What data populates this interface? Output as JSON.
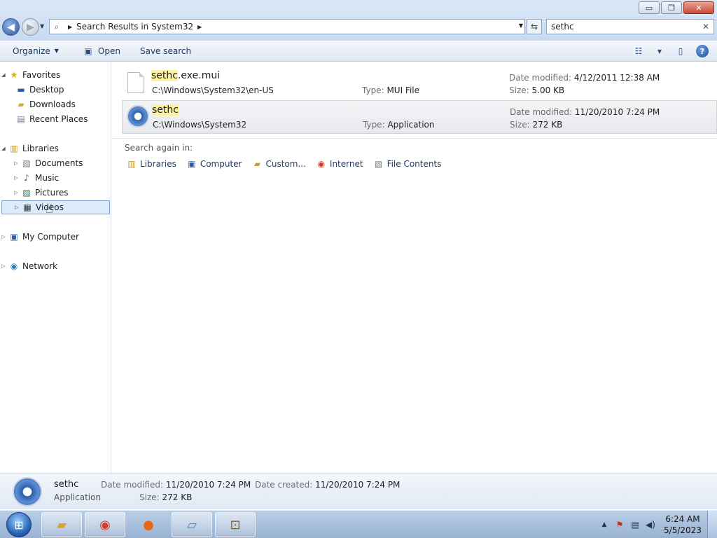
{
  "window": {
    "controls": {
      "minimize": "▭",
      "maximize": "❐",
      "close": "✕"
    }
  },
  "nav": {
    "address_crumb": "Search Results in System32",
    "search_value": "sethc"
  },
  "toolbar": {
    "organize_label": "Organize",
    "open_label": "Open",
    "save_search_label": "Save search"
  },
  "sidebar": {
    "favorites": "Favorites",
    "desktop": "Desktop",
    "downloads": "Downloads",
    "recent_places": "Recent Places",
    "libraries": "Libraries",
    "documents": "Documents",
    "music": "Music",
    "pictures": "Pictures",
    "videos": "Videos",
    "my_computer": "My Computer",
    "network": "Network"
  },
  "results": [
    {
      "name_hit": "sethc",
      "name_rest": ".exe.mui",
      "path": "C:\\Windows\\System32\\en-US",
      "type_label": "Type:",
      "type": "MUI File",
      "date_label": "Date modified:",
      "date": "4/12/2011 12:38 AM",
      "size_label": "Size:",
      "size": "5.00 KB"
    },
    {
      "name_hit": "sethc",
      "name_rest": "",
      "path": "C:\\Windows\\System32",
      "type_label": "Type:",
      "type": "Application",
      "date_label": "Date modified:",
      "date": "11/20/2010 7:24 PM",
      "size_label": "Size:",
      "size": "272 KB"
    }
  ],
  "search_again": {
    "label": "Search again in:",
    "libraries": "Libraries",
    "computer": "Computer",
    "custom": "Custom...",
    "internet": "Internet",
    "file_contents": "File Contents"
  },
  "details": {
    "name": "sethc",
    "type": "Application",
    "date_modified_label": "Date modified:",
    "date_modified": "11/20/2010 7:24 PM",
    "date_created_label": "Date created:",
    "date_created": "11/20/2010 7:24 PM",
    "size_label": "Size:",
    "size": "272 KB"
  },
  "taskbar": {
    "time": "6:24 AM",
    "date": "5/5/2023"
  },
  "colors": {
    "highlight": "#fdf2a3",
    "selection": "#dcebfc"
  }
}
